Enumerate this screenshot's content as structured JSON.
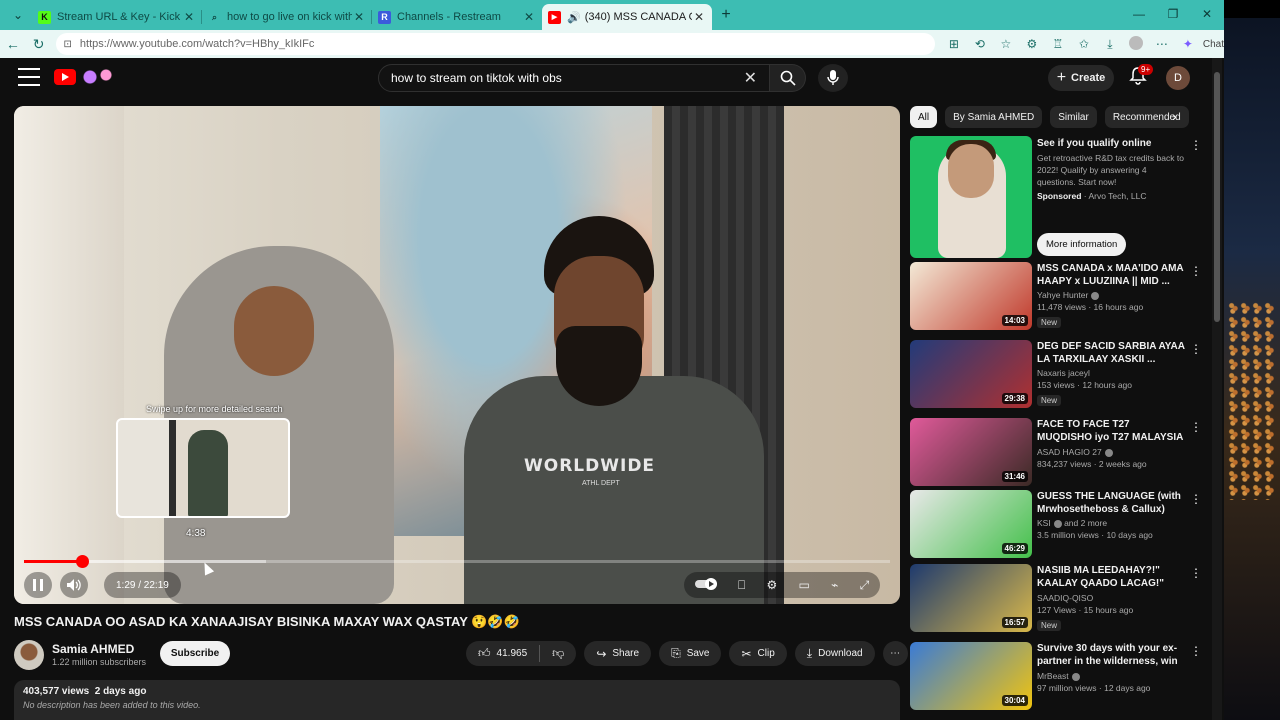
{
  "tabs": [
    {
      "title": "Stream URL & Key - Kick Dashbo...",
      "favicon_color": "#53fc18",
      "favicon_glyph": "K"
    },
    {
      "title": "how to go live on kick with 0 follo...",
      "favicon_color": "#3dbdb3",
      "favicon_glyph": "⌕"
    },
    {
      "title": "Channels - Restream",
      "favicon_color": "#3b5bdb",
      "favicon_glyph": "R"
    },
    {
      "title": "(340) MSS CANADA OO ASAD...",
      "favicon_color": "#ff0000",
      "favicon_glyph": "▶",
      "active": true
    }
  ],
  "address": {
    "url": "https://www.youtube.com/watch?v=HBhy_kIkIFc",
    "chat_label": "Chat"
  },
  "header": {
    "search_value": "how to stream on tiktok with obs",
    "create_label": "Create",
    "notif_count": "9+",
    "account_initial": "D"
  },
  "player": {
    "preview_hint": "Swipe up for more detailed search",
    "preview_time": "4:38",
    "time_display": "1:29 / 22:19",
    "progress_fraction": 0.0665,
    "shirt_text": "WORLDWIDE",
    "shirt_sub": "ATHL DEPT"
  },
  "video": {
    "title": "MSS CANADA OO ASAD KA XANAAJISAY BISINKA MAXAY WAX QASTAY 😲🤣🤣",
    "channel": "Samia AHMED",
    "subscribers": "1.22 million subscribers",
    "subscribe_label": "Subscribe",
    "likes": "41.965",
    "share_label": "Share",
    "save_label": "Save",
    "clip_label": "Clip",
    "download_label": "Download",
    "views": "403,577 views",
    "age": "2 days ago",
    "description": "No description has been added to this video."
  },
  "chips": [
    "All",
    "By Samia AHMED",
    "Similar",
    "Recommended"
  ],
  "ad": {
    "title": "See if you qualify online",
    "description": "Get retroactive R&D tax credits back to 2022! Qualify by answering 4 questions. Start now!",
    "sponsored": "Sponsored",
    "advertiser": "Arvo Tech, LLC",
    "button": "More information"
  },
  "recommendations": [
    {
      "title": "MSS CANADA x MAA'IDO AMA HAAPY x LUUZIINA || MID ...",
      "channel": "Yahye Hunter",
      "verified": true,
      "views": "11,478 views",
      "age": "16 hours ago",
      "duration": "14:03",
      "new": "New",
      "thumb_colors": [
        "#f3e9d6",
        "#c0392b"
      ]
    },
    {
      "title": "DEG DEF SACID SARBIA AYAA LA TARXILAAY XASKII ...",
      "channel": "Naxaris jaceyl",
      "verified": false,
      "views": "153 views",
      "age": "12 hours ago",
      "duration": "29:38",
      "new": "New",
      "thumb_colors": [
        "#223b7a",
        "#b03030"
      ]
    },
    {
      "title": "FACE TO FACE T27 MUQDISHO iyo T27 MALAYSIA IS HOR ...",
      "channel": "ASAD HAGIO 27",
      "verified": true,
      "views": "834,237 views",
      "age": "2 weeks ago",
      "duration": "31:46",
      "new": "",
      "thumb_colors": [
        "#e05a9a",
        "#3b2a25"
      ]
    },
    {
      "title": "GUESS THE LANGUAGE (with Mrwhosetheboss & Callux)",
      "channel": "KSI",
      "verified": true,
      "channel_extra": "and 2 more",
      "views": "3.5 million views",
      "age": "10 days ago",
      "duration": "46:29",
      "new": "",
      "thumb_colors": [
        "#e8e8e8",
        "#43c04a"
      ]
    },
    {
      "title": "NASIIB MA LEEDAHAY?!\" KAALAY QAADO LACAG!\" HAL ...",
      "channel": "SAADIQ-QISO",
      "verified": false,
      "views": "127 Views",
      "age": "15 hours ago",
      "duration": "16:57",
      "new": "New",
      "thumb_colors": [
        "#1e3a6e",
        "#d9b84a"
      ]
    },
    {
      "title": "Survive 30 days with your ex-partner in the wilderness, win ...",
      "channel": "MrBeast",
      "verified": true,
      "views": "97 million views",
      "age": "12 days ago",
      "duration": "30:04",
      "new": "",
      "thumb_colors": [
        "#3a7bd5",
        "#f1c40f"
      ]
    }
  ],
  "colors": {
    "accent": "#ff0000",
    "tabstrip": "#3dbdb3",
    "toolbar": "#e9f7f5"
  }
}
